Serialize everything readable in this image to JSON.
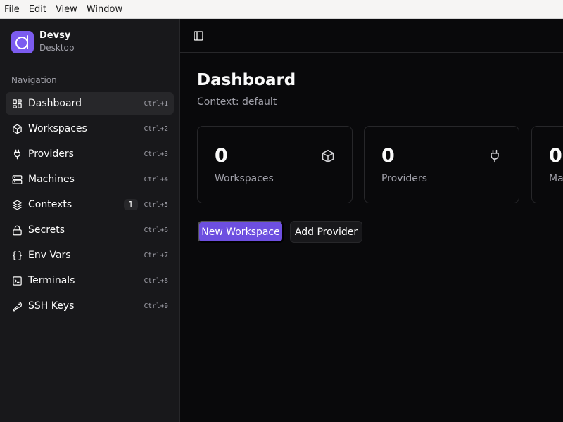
{
  "menubar": [
    "File",
    "Edit",
    "View",
    "Window"
  ],
  "brand": {
    "name": "Devsy",
    "subtitle": "Desktop"
  },
  "sidebar": {
    "section_label": "Navigation",
    "items": [
      {
        "label": "Dashboard",
        "shortcut": "Ctrl+1",
        "icon": "dashboard-icon",
        "active": true
      },
      {
        "label": "Workspaces",
        "shortcut": "Ctrl+2",
        "icon": "cube-icon"
      },
      {
        "label": "Providers",
        "shortcut": "Ctrl+3",
        "icon": "plug-icon"
      },
      {
        "label": "Machines",
        "shortcut": "Ctrl+4",
        "icon": "server-icon"
      },
      {
        "label": "Contexts",
        "shortcut": "Ctrl+5",
        "icon": "layers-icon",
        "badge": "1"
      },
      {
        "label": "Secrets",
        "shortcut": "Ctrl+6",
        "icon": "lock-icon"
      },
      {
        "label": "Env Vars",
        "shortcut": "Ctrl+7",
        "icon": "braces-icon"
      },
      {
        "label": "Terminals",
        "shortcut": "Ctrl+8",
        "icon": "terminal-icon"
      },
      {
        "label": "SSH Keys",
        "shortcut": "Ctrl+9",
        "icon": "key-icon"
      }
    ]
  },
  "header": {
    "toggle_icon": "sidebar-toggle-icon"
  },
  "main": {
    "title": "Dashboard",
    "context_text": "Context: default",
    "cards": [
      {
        "value": "0",
        "label": "Workspaces",
        "icon": "cube-icon"
      },
      {
        "value": "0",
        "label": "Providers",
        "icon": "plug-icon"
      },
      {
        "value": "0",
        "label": "Machines",
        "icon": "server-icon"
      }
    ],
    "buttons": {
      "new_workspace": "New Workspace",
      "add_provider": "Add Provider"
    }
  },
  "colors": {
    "accent": "#6d4fe0",
    "logo": "#7c5cf0",
    "background": "#09090b",
    "sidebar": "#18181b",
    "border": "#27272a"
  }
}
